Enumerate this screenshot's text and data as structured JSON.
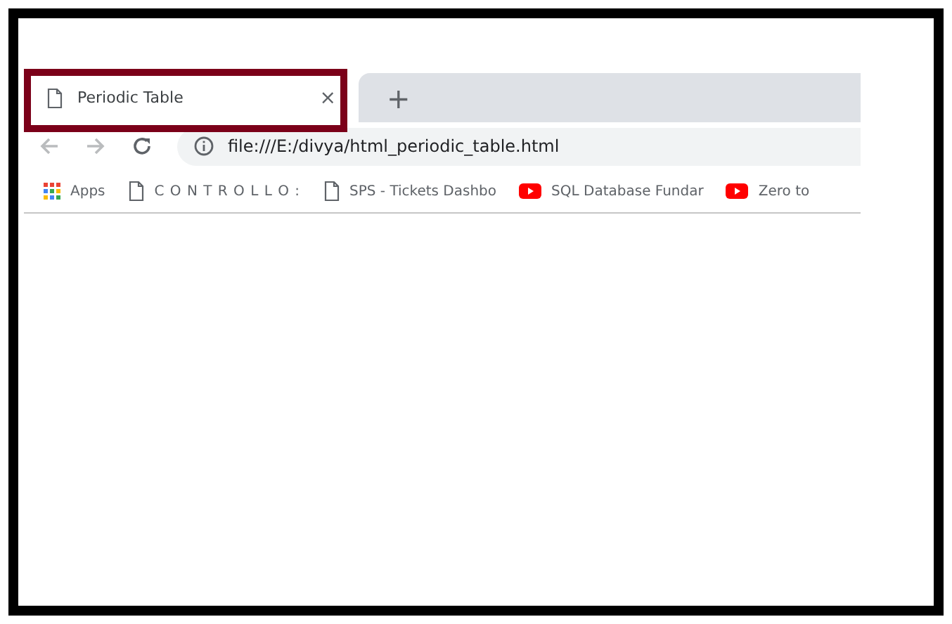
{
  "tabs": [
    {
      "title": "Periodic Table",
      "selected": true,
      "close": "×"
    }
  ],
  "new_tab": "+",
  "address_bar": {
    "value": "file:///E:/divya/html_periodic_table.html"
  },
  "bookmarks": [
    {
      "kind": "apps",
      "label": "Apps"
    },
    {
      "kind": "page",
      "label": "C O N T R O L L O :"
    },
    {
      "kind": "page",
      "label": "SPS - Tickets Dashbo"
    },
    {
      "kind": "video",
      "label": "SQL Database Fundar"
    },
    {
      "kind": "video",
      "label": "Zero to"
    }
  ]
}
